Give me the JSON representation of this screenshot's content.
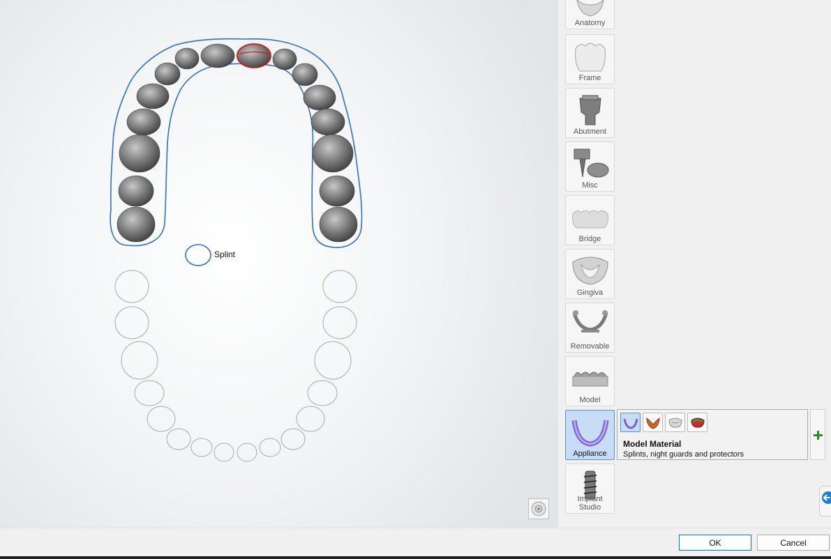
{
  "viewport": {
    "splint_label": "Splint",
    "view_cube_icon": "view-cube-icon",
    "upper_arch_outline_color": "#2e6fcf",
    "selected_tooth_outline_color": "#d01818"
  },
  "sidebar": {
    "tools": [
      {
        "label": "Anatomy",
        "icon": "crown-icon"
      },
      {
        "label": "Frame",
        "icon": "frame-icon"
      },
      {
        "label": "Abutment",
        "icon": "abutment-icon"
      },
      {
        "label": "Misc",
        "icon": "misc-icon"
      },
      {
        "label": "Bridge",
        "icon": "bridge-icon"
      },
      {
        "label": "Gingiva",
        "icon": "gingiva-icon"
      },
      {
        "label": "Removable",
        "icon": "removable-icon"
      },
      {
        "label": "Model",
        "icon": "model-icon"
      },
      {
        "label": "Appliance",
        "icon": "appliance-icon",
        "selected": true
      },
      {
        "label": "Implant Studio",
        "icon": "implant-icon"
      }
    ],
    "material_panel": {
      "title": "Model Material",
      "description": "Splints, night guards and protectors",
      "options": [
        "splint-icon",
        "night-guard-icon",
        "protector-icon",
        "mouthguard-icon"
      ]
    },
    "add_icon": "plus-icon",
    "edge_tab_icon": "back-arrow-icon",
    "accent_color": "#5a8fd6"
  },
  "footer": {
    "ok_label": "OK",
    "cancel_label": "Cancel"
  }
}
